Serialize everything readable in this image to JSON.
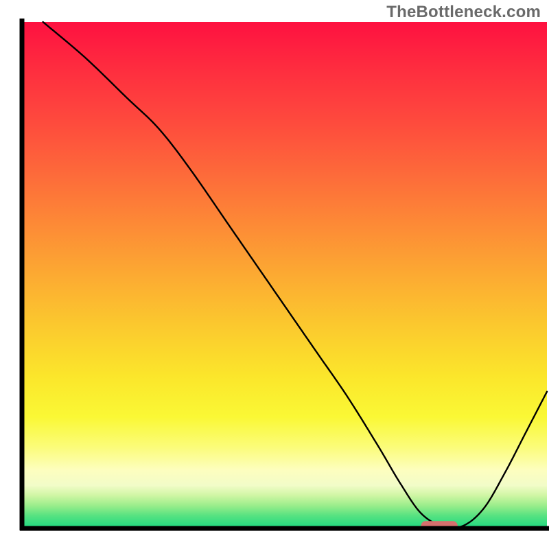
{
  "watermark": "TheBottleneck.com",
  "chart_data": {
    "type": "line",
    "title": "",
    "xlabel": "",
    "ylabel": "",
    "xlim": [
      0,
      100
    ],
    "ylim": [
      0,
      100
    ],
    "series": [
      {
        "name": "curve",
        "x": [
          4,
          12,
          20,
          26,
          32,
          40,
          48,
          56,
          62,
          68,
          72,
          76,
          80,
          84,
          88,
          92,
          96,
          100
        ],
        "y": [
          100,
          93,
          85,
          79,
          71,
          59,
          47,
          35,
          26,
          16,
          9,
          3,
          0.5,
          0.5,
          4,
          11,
          19,
          27
        ]
      }
    ],
    "highlight_segment": {
      "x_start": 76,
      "x_end": 83,
      "y": 0.5
    },
    "gradient_stops": [
      {
        "offset": 0.0,
        "color": "#fe1140"
      },
      {
        "offset": 0.1,
        "color": "#fe2f3f"
      },
      {
        "offset": 0.2,
        "color": "#fe4b3d"
      },
      {
        "offset": 0.3,
        "color": "#fd6a3a"
      },
      {
        "offset": 0.4,
        "color": "#fd8a36"
      },
      {
        "offset": 0.5,
        "color": "#fcaa32"
      },
      {
        "offset": 0.6,
        "color": "#fbc92e"
      },
      {
        "offset": 0.7,
        "color": "#fbe62b"
      },
      {
        "offset": 0.78,
        "color": "#faf835"
      },
      {
        "offset": 0.84,
        "color": "#fbfc7a"
      },
      {
        "offset": 0.885,
        "color": "#fdfebf"
      },
      {
        "offset": 0.915,
        "color": "#f2fcc8"
      },
      {
        "offset": 0.935,
        "color": "#cff6a4"
      },
      {
        "offset": 0.955,
        "color": "#9aed8b"
      },
      {
        "offset": 0.975,
        "color": "#56e281"
      },
      {
        "offset": 1.0,
        "color": "#1cd981"
      }
    ],
    "highlight_color": "#d6706e",
    "axis_color": "#000000",
    "axis_width": 7,
    "curve_color": "#000000",
    "curve_width": 2.4
  }
}
